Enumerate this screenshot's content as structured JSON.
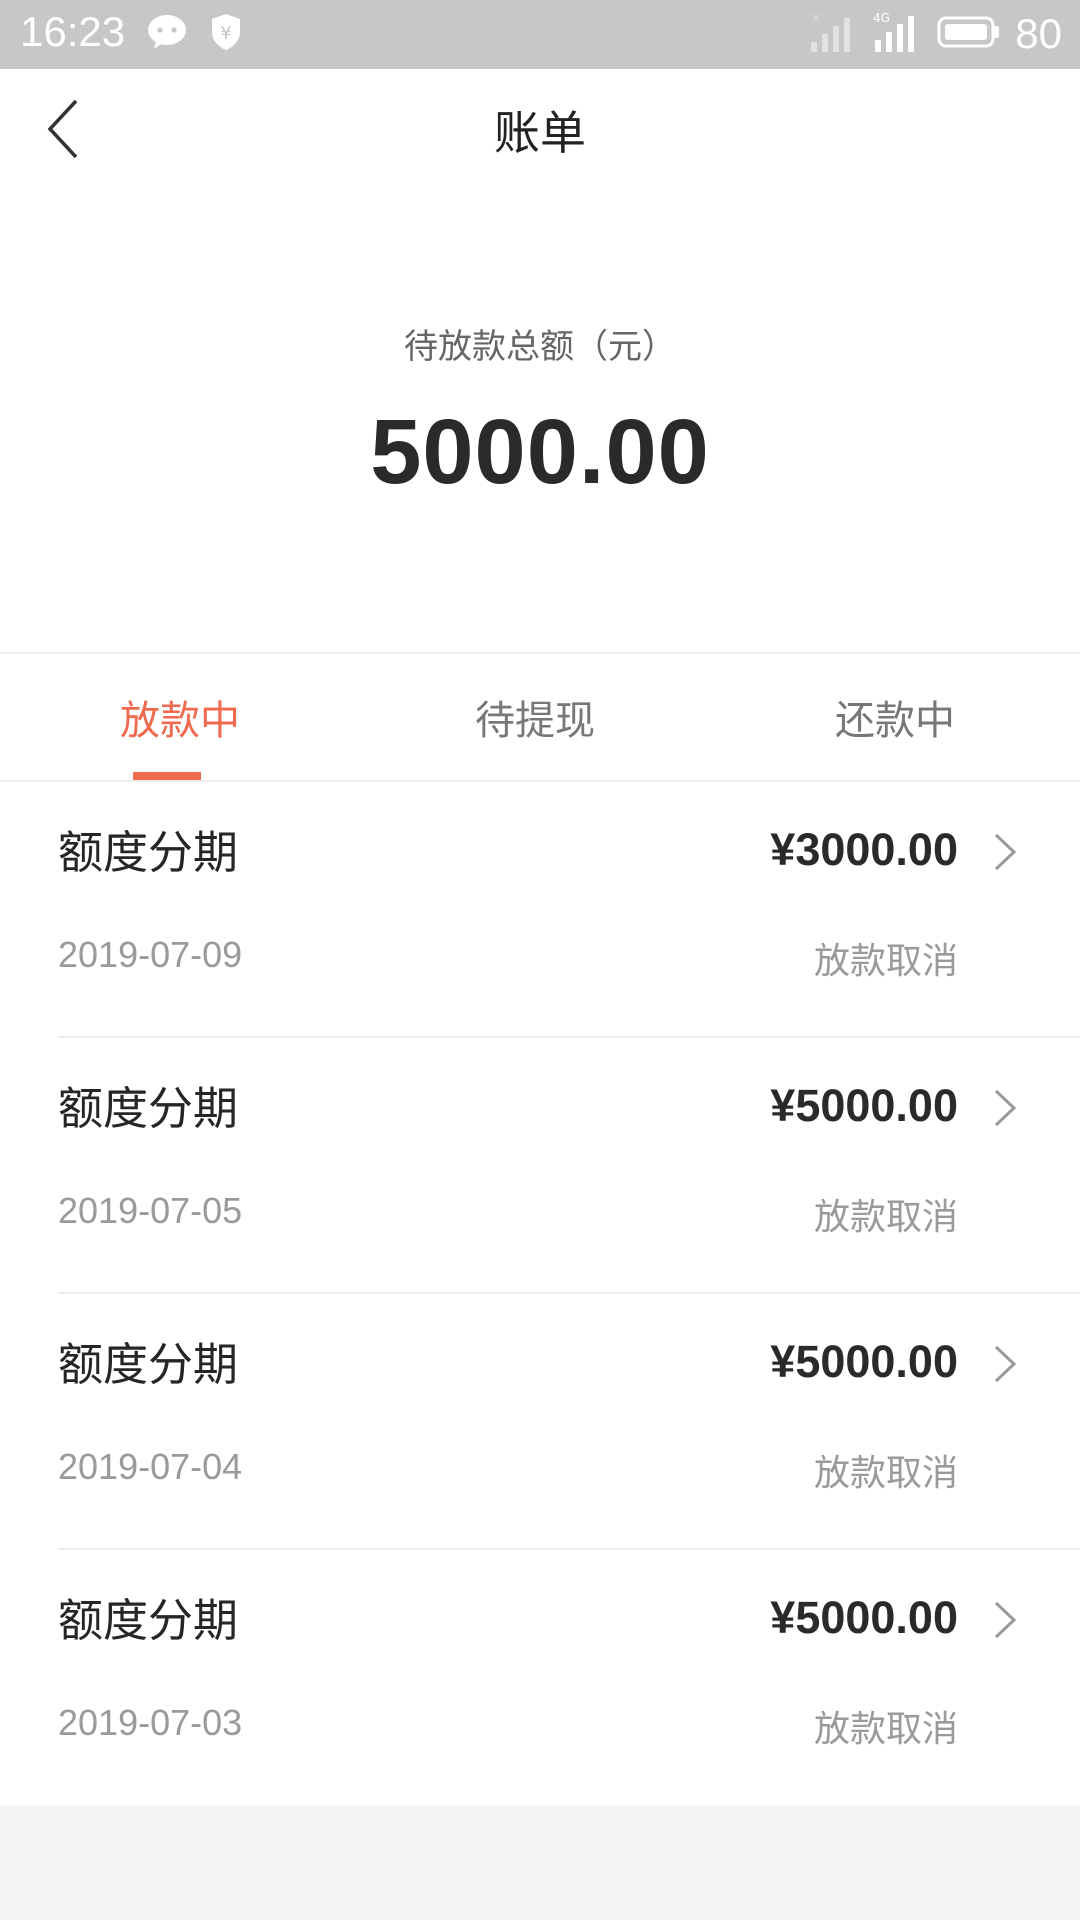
{
  "status_bar": {
    "time": "16:23",
    "battery": "80",
    "network": "4G",
    "icons": [
      "chat-bubble-icon",
      "shield-yen-icon",
      "signal-no-sim-icon",
      "signal-4g-icon",
      "battery-icon"
    ]
  },
  "nav": {
    "title": "账单",
    "back_icon": "chevron-left-icon"
  },
  "summary": {
    "label": "待放款总额（元）",
    "amount": "5000.00"
  },
  "tabs": [
    {
      "label": "放款中",
      "active": true
    },
    {
      "label": "待提现",
      "active": false
    },
    {
      "label": "还款中",
      "active": false
    }
  ],
  "bills": [
    {
      "title": "额度分期",
      "amount": "¥3000.00",
      "date": "2019-07-09",
      "status": "放款取消"
    },
    {
      "title": "额度分期",
      "amount": "¥5000.00",
      "date": "2019-07-05",
      "status": "放款取消"
    },
    {
      "title": "额度分期",
      "amount": "¥5000.00",
      "date": "2019-07-04",
      "status": "放款取消"
    },
    {
      "title": "额度分期",
      "amount": "¥5000.00",
      "date": "2019-07-03",
      "status": "放款取消"
    }
  ],
  "colors": {
    "accent": "#f26c53",
    "status_bar": "#c7c7c7",
    "background": "#f5f5f7"
  }
}
